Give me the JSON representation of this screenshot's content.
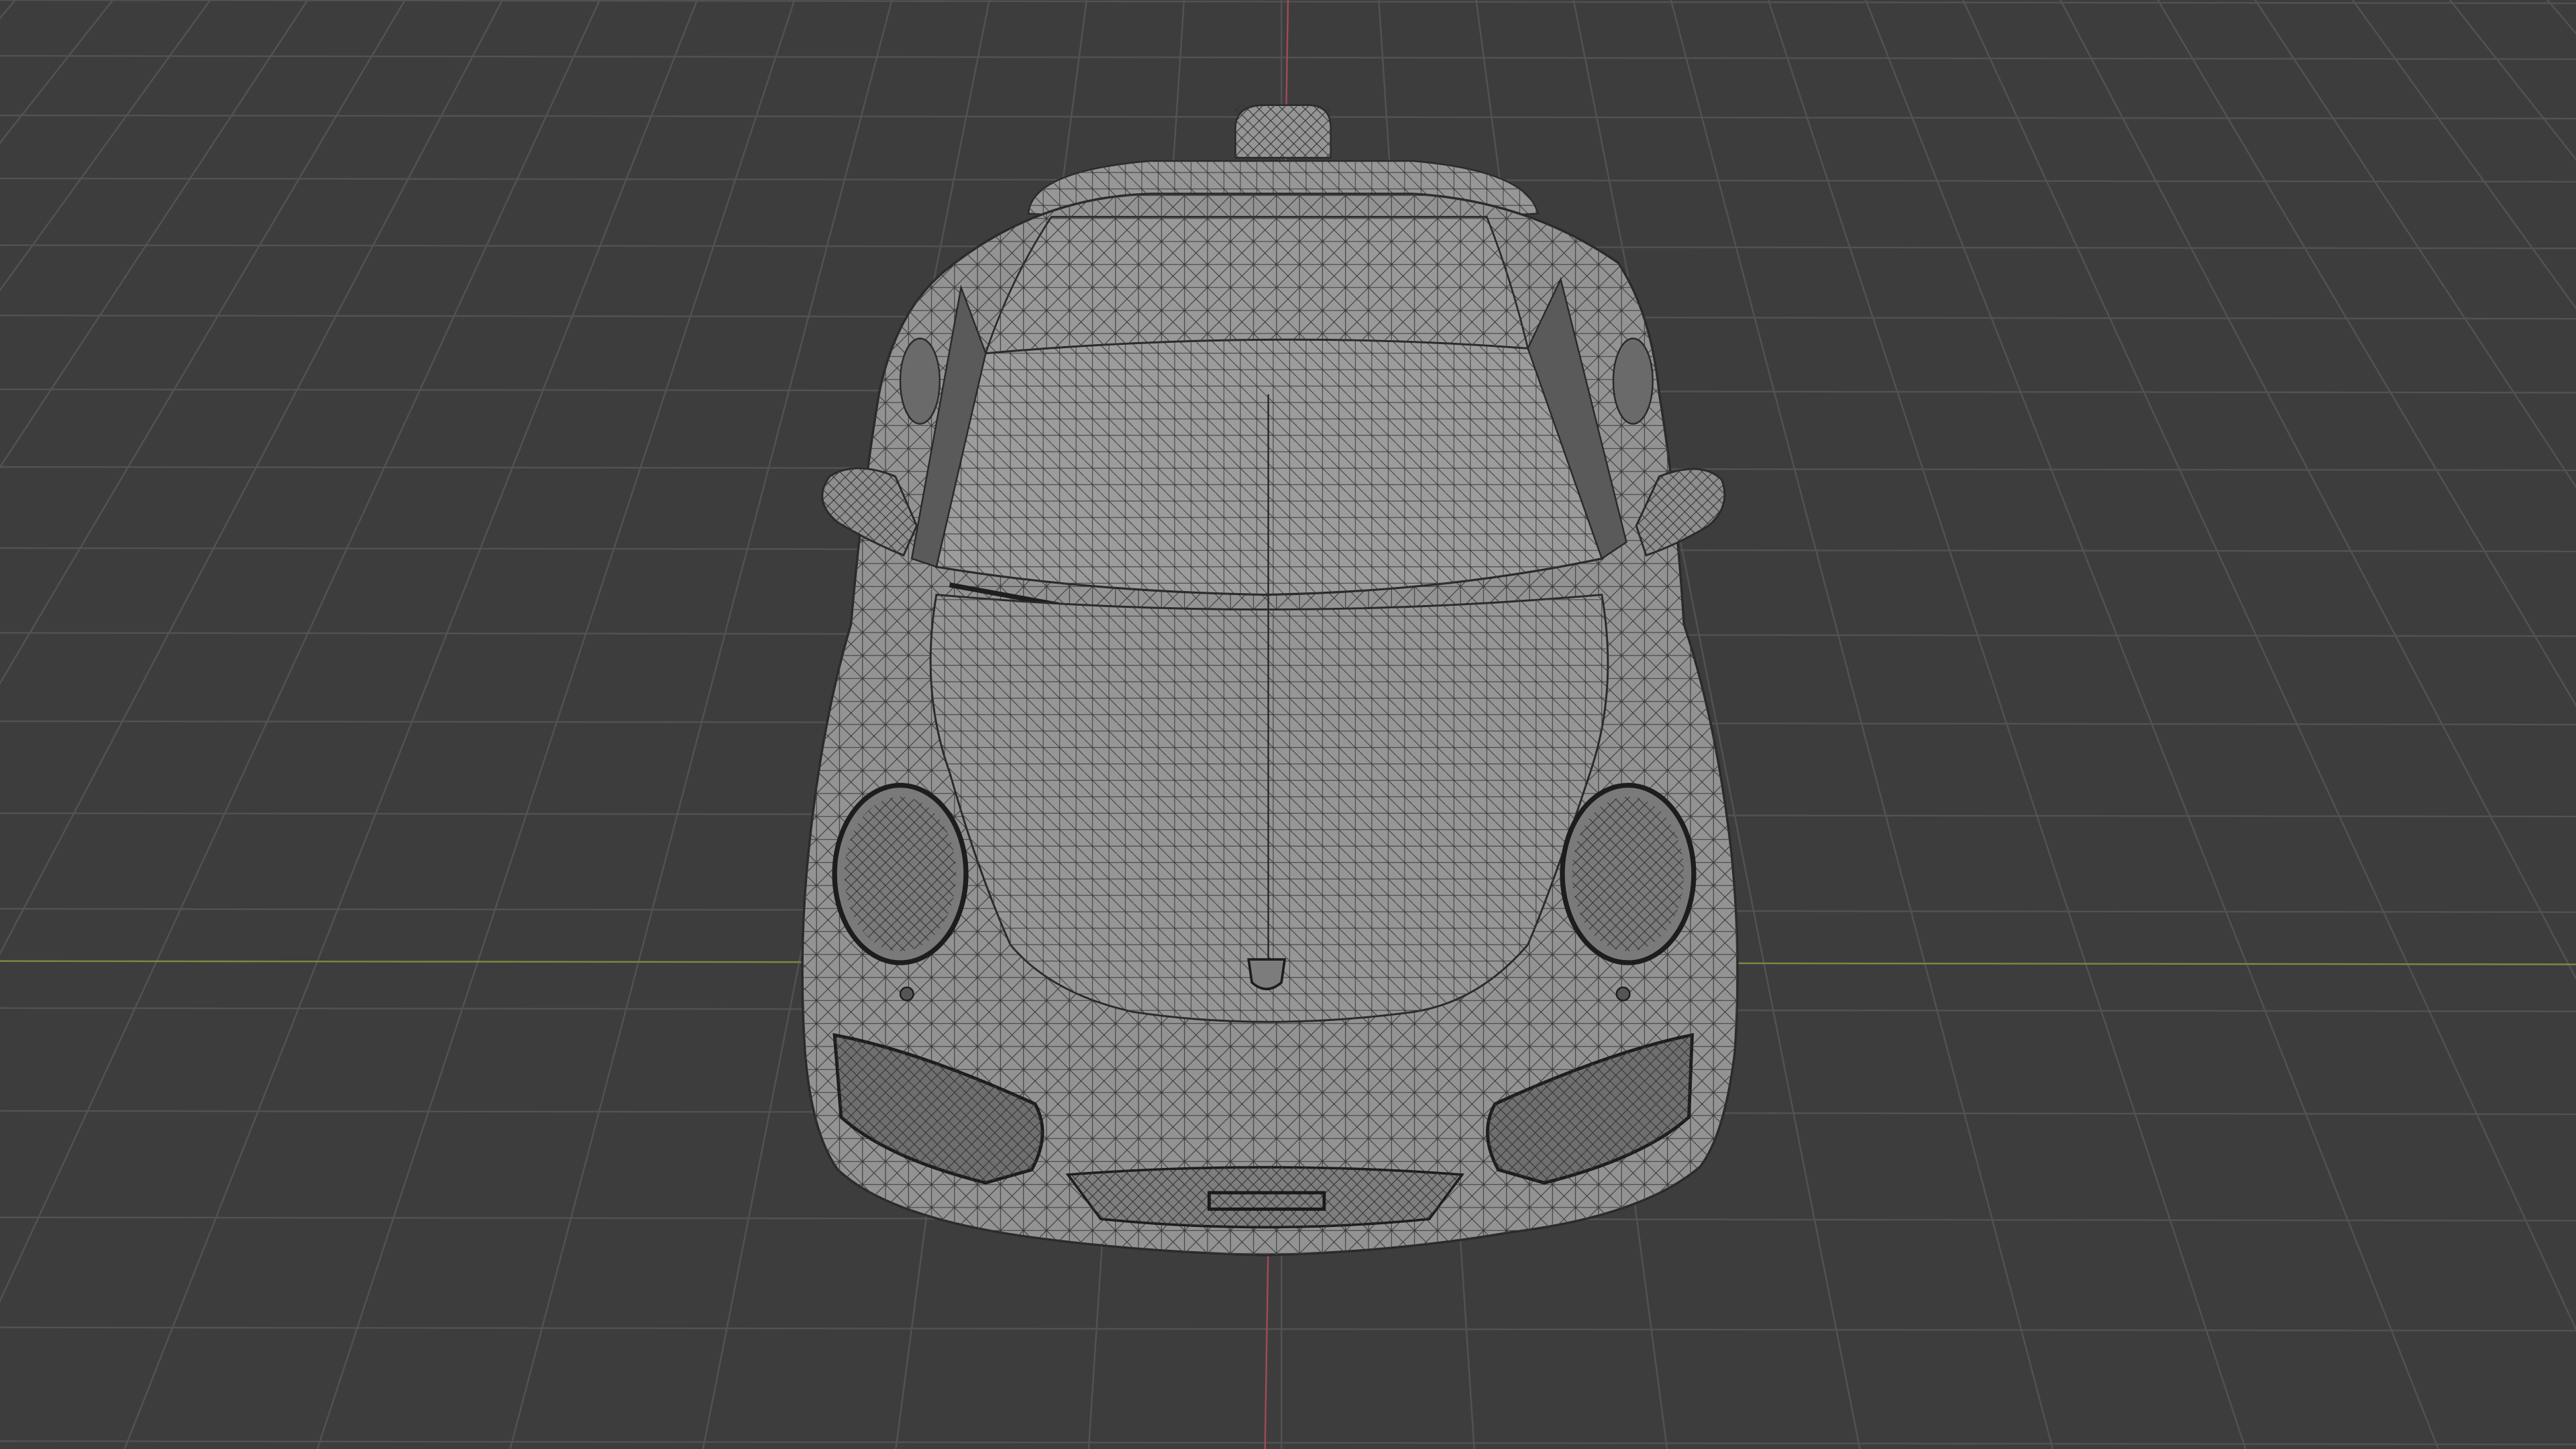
{
  "viewport": {
    "mode": "wireframe-overlay",
    "view": "front-perspective",
    "object": "car-model",
    "background_color": "#3d3d3d",
    "grid_color": "#525252",
    "x_axis_color": "#7b8a3c",
    "z_axis_color": "#a04a55",
    "mesh_fill_color": "#8f8f8f",
    "mesh_line_color": "#2a2a2a"
  }
}
